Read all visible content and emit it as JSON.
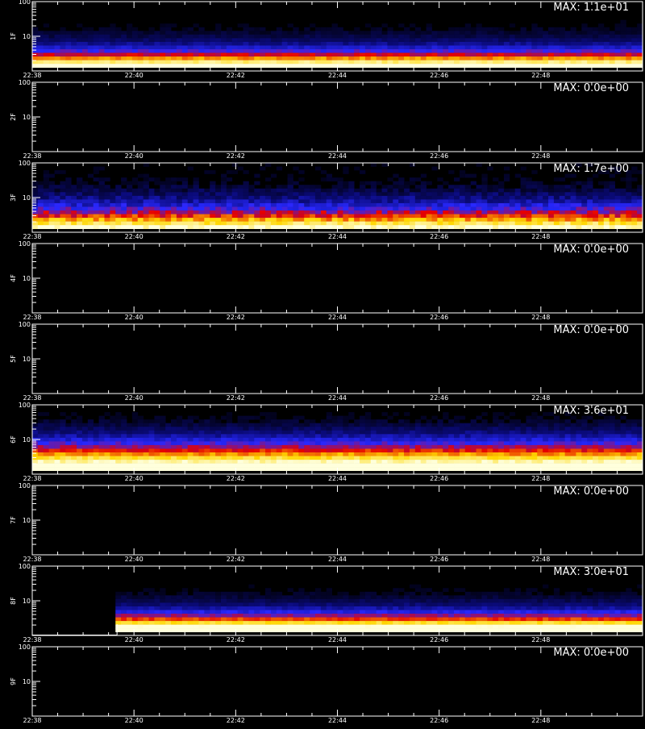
{
  "chart_data": {
    "type": "heatmap",
    "x_tick_labels": [
      "22:38",
      "22:40",
      "22:42",
      "22:44",
      "22:46",
      "22:48"
    ],
    "y_tick_labels": [
      "100",
      "10"
    ],
    "y_scale": "log",
    "ylim": [
      1,
      100
    ],
    "panels": [
      {
        "label": "1F",
        "max_text": "MAX: 1.1e+01",
        "max": 11,
        "active": true,
        "blank_until": null
      },
      {
        "label": "2F",
        "max_text": "MAX: 0.0e+00",
        "max": 0,
        "active": false,
        "blank_until": null
      },
      {
        "label": "3F",
        "max_text": "MAX: 1.7e+00",
        "max": 1.7,
        "active": true,
        "blank_until": null
      },
      {
        "label": "4F",
        "max_text": "MAX: 0.0e+00",
        "max": 0,
        "active": false,
        "blank_until": null
      },
      {
        "label": "5F",
        "max_text": "MAX: 0.0e+00",
        "max": 0,
        "active": false,
        "blank_until": null
      },
      {
        "label": "6F",
        "max_text": "MAX: 3.6e+01",
        "max": 36,
        "active": true,
        "blank_until": null
      },
      {
        "label": "7F",
        "max_text": "MAX: 0.0e+00",
        "max": 0,
        "active": false,
        "blank_until": null
      },
      {
        "label": "8F",
        "max_text": "MAX: 3.0e+01",
        "max": 30,
        "active": true,
        "blank_until": "22:39:40"
      },
      {
        "label": "9F",
        "max_text": "MAX: 0.0e+00",
        "max": 0,
        "active": false,
        "blank_until": null
      }
    ]
  },
  "footer_text": ""
}
